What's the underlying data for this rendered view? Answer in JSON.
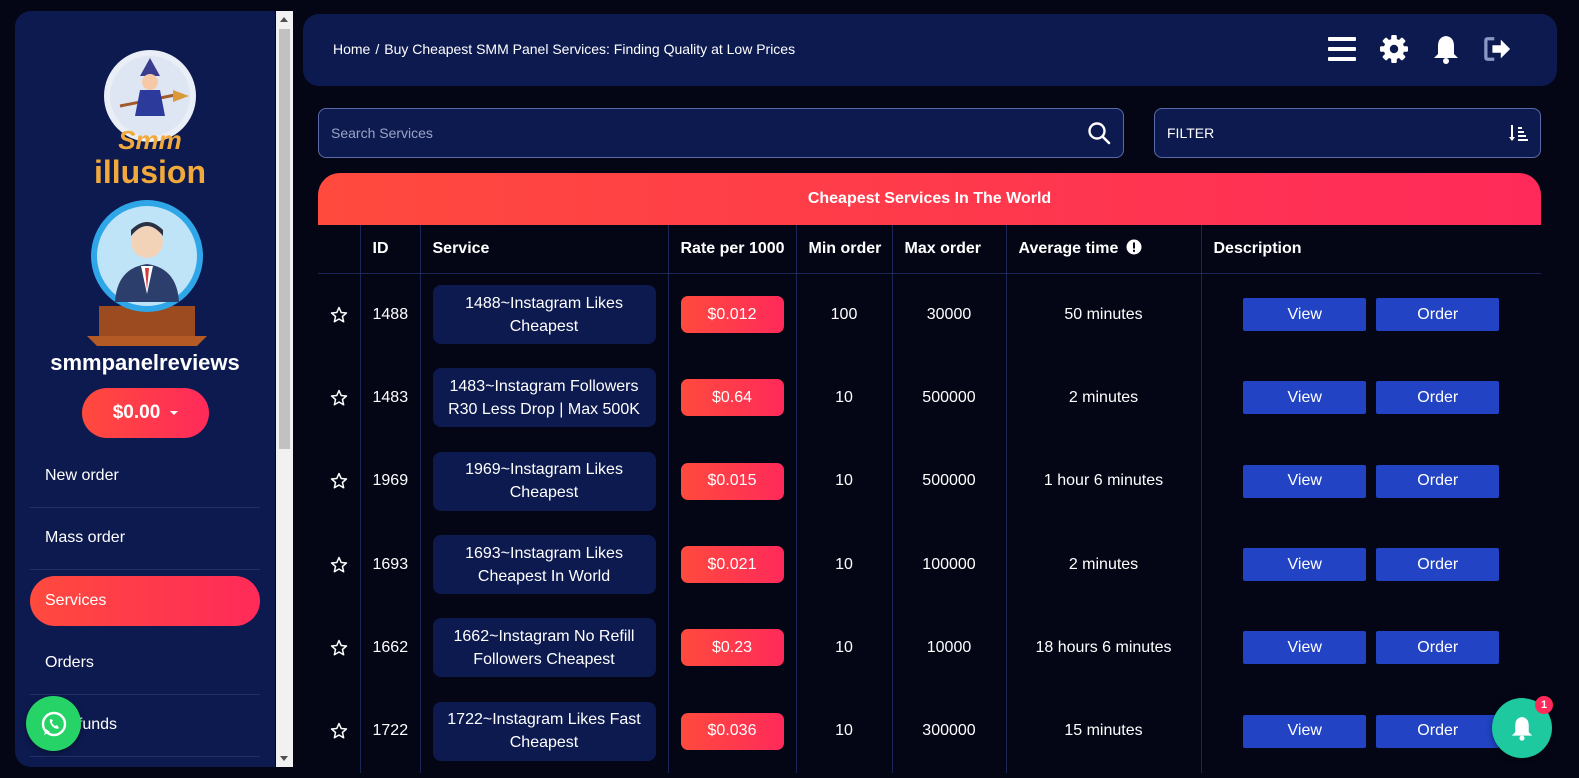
{
  "sidebar": {
    "username": "smmpanelreviews",
    "balance": "$0.00",
    "menu": [
      "New order",
      "Mass order",
      "Services",
      "Orders",
      "Add funds"
    ],
    "active": "Services"
  },
  "header": {
    "breadcrumb": [
      "Home",
      "/",
      "Buy Cheapest SMM Panel Services: Finding Quality at Low Prices"
    ],
    "icons": [
      "menu-icon",
      "gear-icon",
      "bell-icon",
      "logout-icon"
    ]
  },
  "search": {
    "placeholder": "Search Services"
  },
  "filter": {
    "label": "FILTER"
  },
  "table": {
    "title": "Cheapest Services In The World",
    "columns": [
      "",
      "ID",
      "Service",
      "Rate per 1000",
      "Min order",
      "Max order",
      "Average time",
      "Description"
    ],
    "view_label": "View",
    "order_label": "Order",
    "rows": [
      {
        "id": "1488",
        "service": "1488~Instagram Likes Cheapest",
        "rate": "$0.012",
        "min": "100",
        "max": "30000",
        "time": "50 minutes"
      },
      {
        "id": "1483",
        "service": "1483~Instagram Followers R30 Less Drop | Max 500K",
        "rate": "$0.64",
        "min": "10",
        "max": "500000",
        "time": "2 minutes"
      },
      {
        "id": "1969",
        "service": "1969~Instagram Likes Cheapest",
        "rate": "$0.015",
        "min": "10",
        "max": "500000",
        "time": "1 hour 6 minutes"
      },
      {
        "id": "1693",
        "service": "1693~Instagram Likes Cheapest In World",
        "rate": "$0.021",
        "min": "10",
        "max": "100000",
        "time": "2 minutes"
      },
      {
        "id": "1662",
        "service": "1662~Instagram No Refill Followers Cheapest",
        "rate": "$0.23",
        "min": "10",
        "max": "10000",
        "time": "18 hours 6 minutes"
      },
      {
        "id": "1722",
        "service": "1722~Instagram Likes Fast Cheapest",
        "rate": "$0.036",
        "min": "10",
        "max": "300000",
        "time": "15 minutes"
      }
    ]
  },
  "notification": {
    "count": "1"
  },
  "colors": {
    "accent": "#ff2a5a",
    "panel": "#0d1a4f",
    "button": "#2143c4",
    "whatsapp": "#25d366",
    "notif": "#1ec9a0"
  }
}
